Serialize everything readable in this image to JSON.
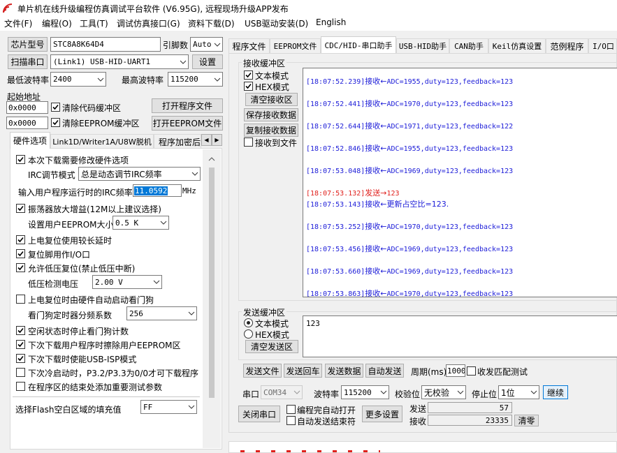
{
  "window": {
    "title": "单片机在线升级编程仿真调试平台软件 (V6.95G), 远程现场升级APP发布"
  },
  "menu": [
    "文件(F)",
    "编程(O)",
    "工具(T)",
    "调试仿真接口(G)",
    "资料下载(D)",
    "USB驱动安装(D)",
    "English"
  ],
  "left": {
    "chip_btn": "芯片型号",
    "chip_value": "STC8A8K64D4",
    "pins_label": "引脚数",
    "pins_value": "Auto",
    "scan_btn": "扫描串口",
    "port_value": "(Link1) USB-HID-UART1",
    "settings_btn": "设置",
    "min_baud_label": "最低波特率",
    "min_baud_value": "2400",
    "max_baud_label": "最高波特率",
    "max_baud_value": "115200",
    "start_addr_label": "起始地址",
    "addr1": "0x0000",
    "clear_code_label": "清除代码缓冲区",
    "open_prog_btn": "打开程序文件",
    "addr2": "0x0000",
    "clear_eeprom_label": "清除EEPROM缓冲区",
    "open_eeprom_btn": "打开EEPROM文件",
    "tabs": [
      "硬件选项",
      "Link1D/Writer1A/U8W脱机",
      "程序加密后"
    ],
    "hw": {
      "opt1": "本次下载需要修改硬件选项",
      "irc_mode_label": "IRC调节模式",
      "irc_mode_value": "总是动态调节IRC频率",
      "irc_freq_label": "输入用户程序运行时的IRC频率",
      "irc_freq_value": "11.0592",
      "irc_freq_unit": "MHz",
      "opt2": "振荡器放大增益(12M以上建议选择)",
      "eeprom_size_label": "设置用户EEPROM大小",
      "eeprom_size_value": "0.5 K",
      "opt3": "上电复位使用较长延时",
      "opt4": "复位脚用作I/O口",
      "opt5": "允许低压复位(禁止低压中断)",
      "lvd_label": "低压检测电压",
      "lvd_value": "2.00 V",
      "opt6": "上电复位时由硬件自动启动看门狗",
      "wdt_label": "看门狗定时器分频系数",
      "wdt_value": "256",
      "opt7": "空闲状态时停止看门狗计数",
      "opt8": "下次下载用户程序时擦除用户EEPROM区",
      "opt9": "下次下载时使能USB-ISP模式",
      "opt10": "下次冷启动时，P3.2/P3.3为0/0才可下载程序",
      "opt11": "在程序区的结束处添加重要测试参数",
      "fill_label": "选择Flash空白区域的填充值",
      "fill_value": "FF"
    }
  },
  "right": {
    "tabs": [
      "程序文件",
      "EEPROM文件",
      "CDC/HID-串口助手",
      "USB-HID助手",
      "CAN助手",
      "Keil仿真设置",
      "范例程序",
      "I/O口"
    ],
    "recv_group": "接收缓冲区",
    "text_mode": "文本模式",
    "hex_mode": "HEX模式",
    "clear_recv_btn": "清空接收区",
    "save_recv_btn": "保存接收数据",
    "copy_recv_btn": "复制接收数据",
    "recv_to_file": "接收到文件",
    "log": [
      {
        "ts": "[18:07:52.239]",
        "dir": "接收←",
        "msg": "ADC=1955,duty=123,feedback=123",
        "color": "blue"
      },
      {
        "ts": "[18:07:52.441]",
        "dir": "接收←",
        "msg": "ADC=1970,duty=123,feedback=123",
        "color": "blue"
      },
      {
        "ts": "[18:07:52.644]",
        "dir": "接收←",
        "msg": "ADC=1971,duty=123,feedback=122",
        "color": "blue"
      },
      {
        "ts": "[18:07:52.846]",
        "dir": "接收←",
        "msg": "ADC=1955,duty=123,feedback=123",
        "color": "blue"
      },
      {
        "ts": "[18:07:53.048]",
        "dir": "接收←",
        "msg": "ADC=1969,duty=123,feedback=123",
        "color": "blue"
      },
      {
        "ts": "[18:07:53.132]",
        "dir": "发送→",
        "msg": "123",
        "color": "red"
      },
      {
        "ts": "[18:07:53.143]",
        "dir": "接收←",
        "msg": "更新占空比=123.",
        "color": "blue"
      },
      {
        "ts": "[18:07:53.252]",
        "dir": "接收←",
        "msg": "ADC=1970,duty=123,feedback=123",
        "color": "blue"
      },
      {
        "ts": "[18:07:53.456]",
        "dir": "接收←",
        "msg": "ADC=1969,duty=123,feedback=123",
        "color": "blue"
      },
      {
        "ts": "[18:07:53.660]",
        "dir": "接收←",
        "msg": "ADC=1969,duty=123,feedback=123",
        "color": "blue"
      },
      {
        "ts": "[18:07:53.863]",
        "dir": "接收←",
        "msg": "ADC=1970,duty=123,feedback=123",
        "color": "blue"
      }
    ],
    "send_group": "发送缓冲区",
    "send_text_mode": "文本模式",
    "send_hex_mode": "HEX模式",
    "clear_send_btn": "清空发送区",
    "send_value": "123",
    "send_file_btn": "发送文件",
    "send_cr_btn": "发送回车",
    "send_data_btn": "发送数据",
    "auto_send_btn": "自动发送",
    "period_label": "周期(ms)",
    "period_value": "1000",
    "match_label": "收发匹配测试",
    "port_label": "串口",
    "port_value": "COM34",
    "baud_label": "波特率",
    "baud_value": "115200",
    "parity_label": "校验位",
    "parity_value": "无校验",
    "stop_label": "停止位",
    "stop_value": "1位",
    "continue_btn": "继续",
    "close_port_btn": "关闭串口",
    "auto_open_label": "编程完自动打开",
    "auto_end_label": "自动发送结束符",
    "more_btn": "更多设置",
    "sent_label": "发送",
    "sent_value": "57",
    "recv_label": "接收",
    "recv_value": "23335",
    "clear_count_btn": "清零"
  },
  "colors": {
    "recv_text": "#1c1cd8",
    "send_text": "#e0201c",
    "selection": "#0078d7"
  }
}
